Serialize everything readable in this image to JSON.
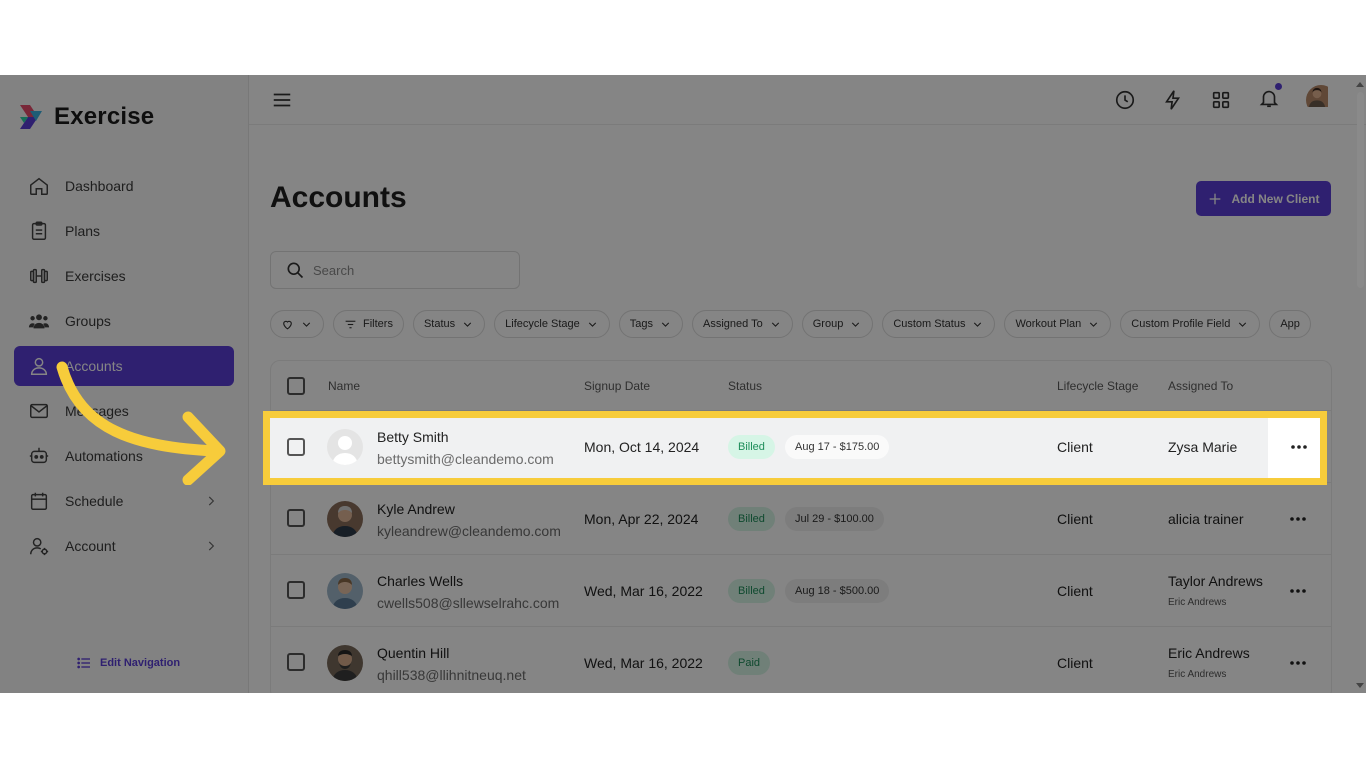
{
  "app": {
    "name": "Exercise"
  },
  "sidebar": {
    "items": [
      {
        "label": "Dashboard",
        "icon": "home-icon"
      },
      {
        "label": "Plans",
        "icon": "clipboard-icon"
      },
      {
        "label": "Exercises",
        "icon": "dumbbell-icon"
      },
      {
        "label": "Groups",
        "icon": "users-icon"
      },
      {
        "label": "Accounts",
        "icon": "user-icon",
        "active": true
      },
      {
        "label": "Messages",
        "icon": "mail-icon"
      },
      {
        "label": "Automations",
        "icon": "robot-icon"
      },
      {
        "label": "Schedule",
        "icon": "calendar-icon",
        "has_submenu": true
      },
      {
        "label": "Account",
        "icon": "user-gear-icon",
        "has_submenu": true
      }
    ],
    "edit_navigation": "Edit Navigation"
  },
  "topbar": {
    "icons": [
      "history-icon",
      "lightning-icon",
      "grid-icon",
      "bell-icon",
      "avatar"
    ]
  },
  "page": {
    "title": "Accounts",
    "add_button": "Add New Client",
    "search_placeholder": "Search"
  },
  "filters": [
    "Filters",
    "Status",
    "Lifecycle Stage",
    "Tags",
    "Assigned To",
    "Group",
    "Custom Status",
    "Workout Plan",
    "Custom Profile Field",
    "App"
  ],
  "table": {
    "columns": {
      "name": "Name",
      "signup": "Signup Date",
      "status": "Status",
      "stage": "Lifecycle Stage",
      "assigned": "Assigned To"
    },
    "rows": [
      {
        "name": "Betty Smith",
        "email": "bettysmith@cleandemo.com",
        "signup": "Mon, Oct 14, 2024",
        "status": "Billed",
        "billing": "Aug 17 - $175.00",
        "stage": "Client",
        "assigned": "Zysa Marie",
        "assigned_sub": ""
      },
      {
        "name": "Kyle Andrew",
        "email": "kyleandrew@cleandemo.com",
        "signup": "Mon, Apr 22, 2024",
        "status": "Billed",
        "billing": "Jul 29 - $100.00",
        "stage": "Client",
        "assigned": "alicia trainer",
        "assigned_sub": ""
      },
      {
        "name": "Charles Wells",
        "email": "cwells508@sllewselrahc.com",
        "signup": "Wed, Mar 16, 2022",
        "status": "Billed",
        "billing": "Aug 18 - $500.00",
        "stage": "Client",
        "assigned": "Taylor Andrews",
        "assigned_sub": "Eric Andrews"
      },
      {
        "name": "Quentin Hill",
        "email": "qhill538@llihnitneuq.net",
        "signup": "Wed, Mar 16, 2022",
        "status": "Paid",
        "billing": "",
        "stage": "Client",
        "assigned": "Eric Andrews",
        "assigned_sub": "Eric Andrews"
      }
    ]
  },
  "colors": {
    "accent": "#5b3fd6",
    "highlight": "#f7cc3b",
    "billed_bg": "#d6f5e6",
    "billed_text": "#1e8e5a"
  }
}
